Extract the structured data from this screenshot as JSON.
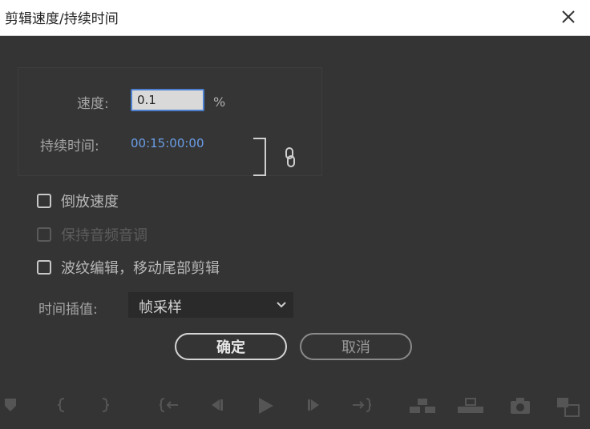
{
  "dialog": {
    "title": "剪辑速度/持续时间",
    "close_icon": "close-icon"
  },
  "speed": {
    "label": "速度:",
    "value": "0.1",
    "unit": "%"
  },
  "duration": {
    "label": "持续时间:",
    "value": "00:15:00:00",
    "link_icon": "chain-link-icon"
  },
  "options": {
    "reverse_speed": {
      "label": "倒放速度",
      "checked": false,
      "enabled": true
    },
    "maintain_pitch": {
      "label": "保持音频音调",
      "checked": false,
      "enabled": false
    },
    "ripple_edit": {
      "label": "波纹编辑，移动尾部剪辑",
      "checked": false,
      "enabled": true
    }
  },
  "interpolation": {
    "label": "时间插值:",
    "selected": "帧采样"
  },
  "buttons": {
    "ok": "确定",
    "cancel": "取消"
  },
  "colors": {
    "background": "#343434",
    "accent_blue": "#6a9ee8",
    "input_focus": "#4b7fd0"
  },
  "transport_icons": [
    "marker-icon",
    "mark-in-icon",
    "mark-out-icon",
    "go-to-in-icon",
    "step-back-icon",
    "play-icon",
    "step-forward-icon",
    "go-to-out-icon",
    "insert-icon",
    "overwrite-icon",
    "export-frame-icon",
    "button-editor-icon"
  ]
}
